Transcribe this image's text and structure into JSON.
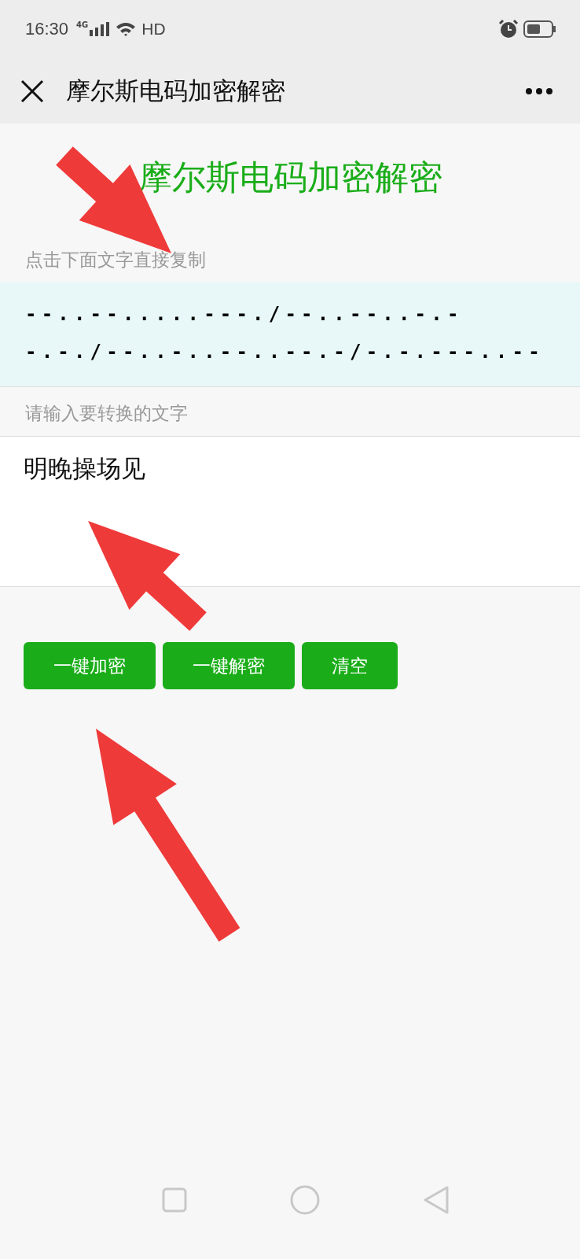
{
  "status_bar": {
    "time": "16:30",
    "network": "4G",
    "hd": "HD"
  },
  "nav": {
    "title": "摩尔斯电码加密解密"
  },
  "heading": "摩尔斯电码加密解密",
  "output": {
    "label": "点击下面文字直接复制",
    "value": "--..--.....---./--..--..-.-\n-.-./--..-..--..--.-/-.-.---..--"
  },
  "input": {
    "label": "请输入要转换的文字",
    "value": "明晚操场见"
  },
  "buttons": [
    "一键加密",
    "一键解密",
    "清空"
  ]
}
